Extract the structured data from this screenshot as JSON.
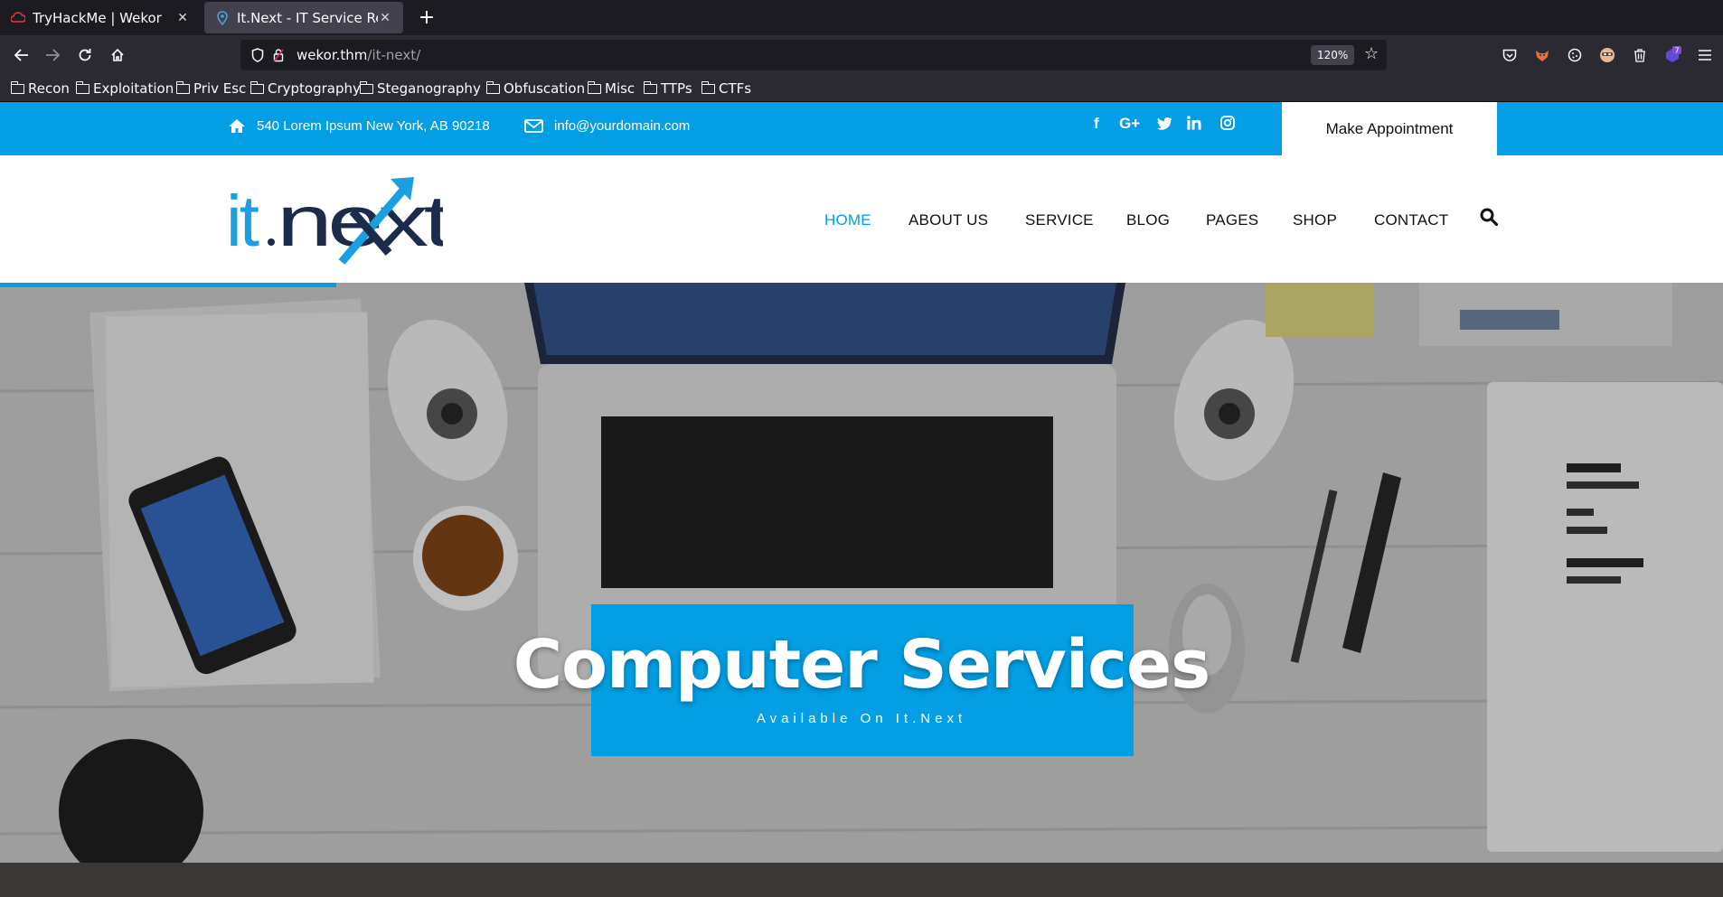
{
  "browser": {
    "tabs": [
      {
        "title": "TryHackMe | Wekor",
        "active": false
      },
      {
        "title": "It.Next - IT Service Respor",
        "active": true
      }
    ],
    "url": {
      "host": "wekor.thm",
      "path": "/it-next/"
    },
    "zoom": "120%",
    "bookmarks": [
      "Recon",
      "Exploitation",
      "Priv Esc",
      "Cryptography",
      "Steganography",
      "Obfuscation",
      "Misc",
      "TTPs",
      "CTFs"
    ],
    "extension_badge": "7"
  },
  "topbar": {
    "address": "540 Lorem Ipsum New York, AB 90218",
    "email": "info@yourdomain.com",
    "social": [
      "facebook-icon",
      "google-plus-icon",
      "twitter-icon",
      "linkedin-icon",
      "instagram-icon"
    ],
    "appointment_label": "Make Appointment"
  },
  "logo": {
    "text_it": "it",
    "text_next": "next"
  },
  "menu": [
    {
      "label": "HOME",
      "active": true
    },
    {
      "label": "ABOUT US",
      "active": false
    },
    {
      "label": "SERVICE",
      "active": false
    },
    {
      "label": "BLOG",
      "active": false
    },
    {
      "label": "PAGES",
      "active": false
    },
    {
      "label": "SHOP",
      "active": false
    },
    {
      "label": "CONTACT",
      "active": false
    }
  ],
  "hero": {
    "title": "Computer Services",
    "subtitle": "Available On It.Next"
  },
  "colors": {
    "brand": "#039ee3",
    "dark": "#1c2a4b"
  }
}
